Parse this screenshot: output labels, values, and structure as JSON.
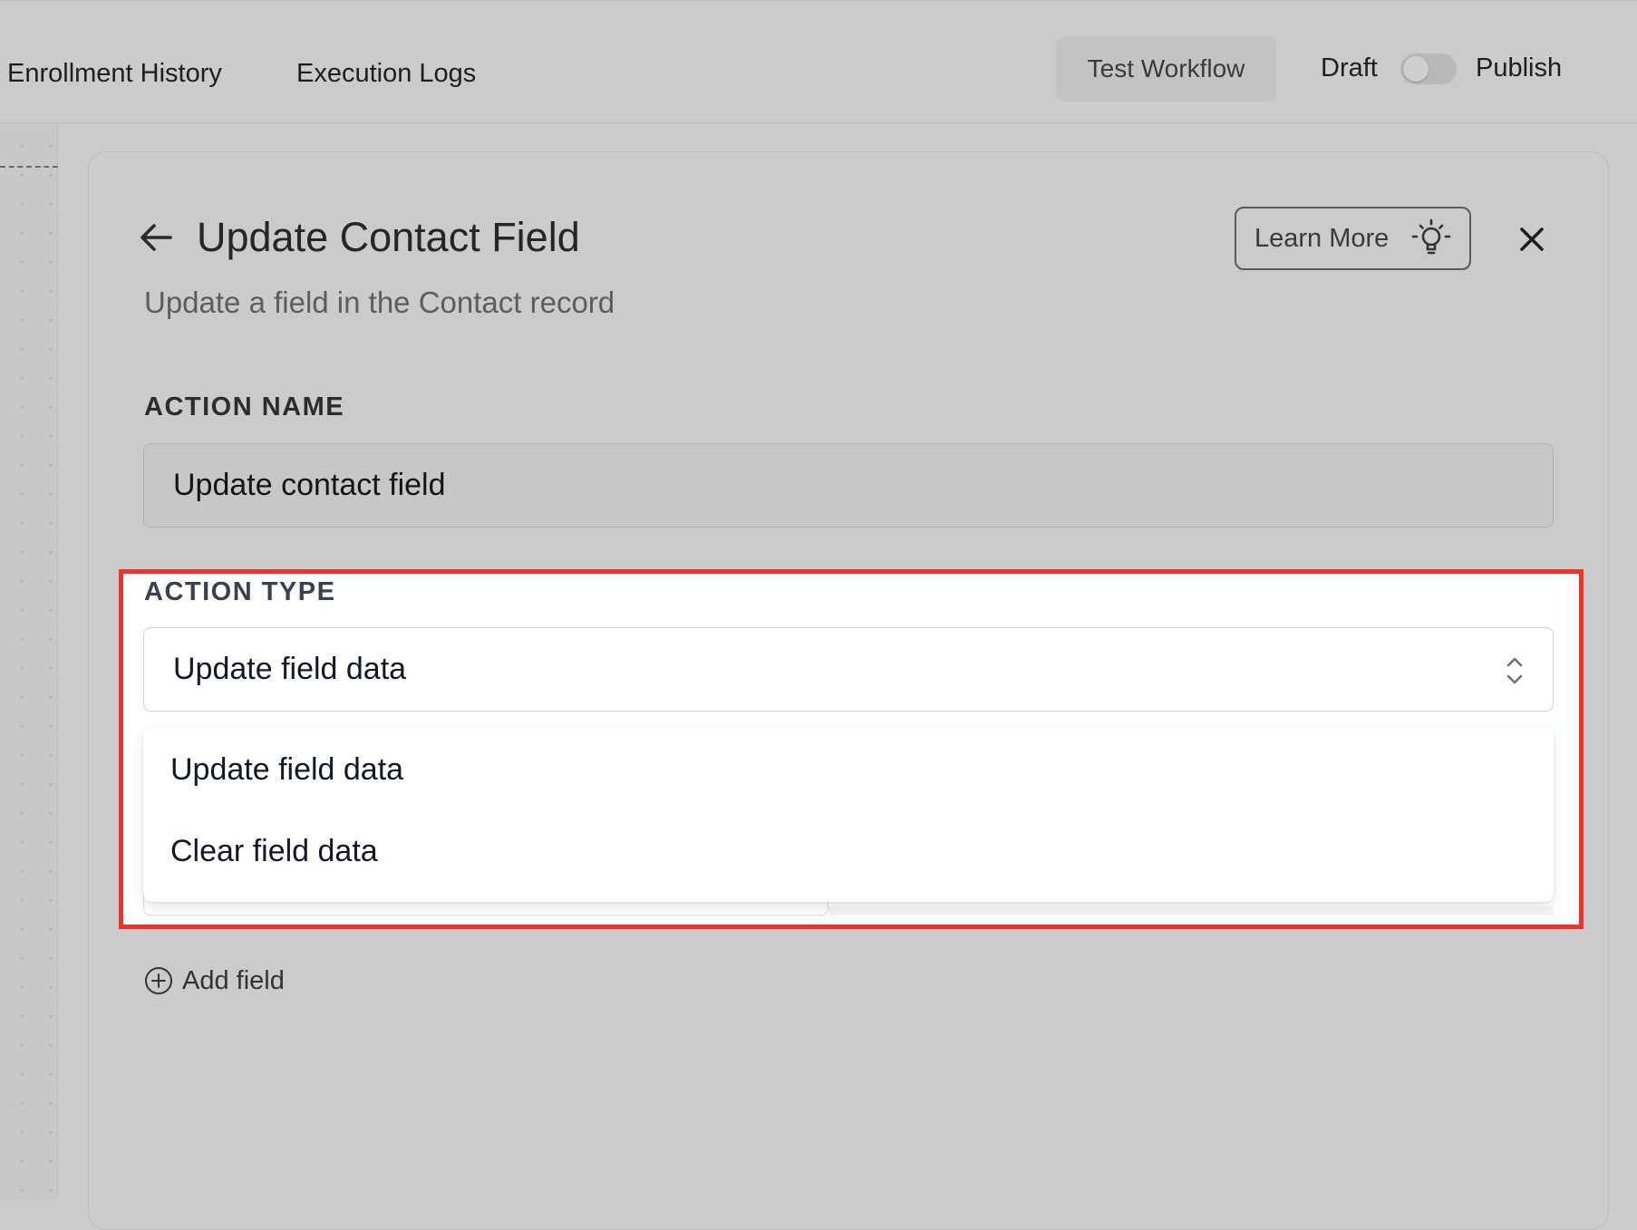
{
  "topbar": {
    "tabs": [
      "Enrollment History",
      "Execution Logs"
    ],
    "test_button": "Test Workflow",
    "draft_label": "Draft",
    "publish_label": "Publish",
    "publish_toggle_on": false
  },
  "panel": {
    "title": "Update Contact Field",
    "subtitle": "Update a field in the Contact record",
    "learn_more": "Learn More",
    "action_name": {
      "label": "ACTION NAME",
      "value": "Update contact field"
    },
    "action_type": {
      "label": "ACTION TYPE",
      "selected": "Update field data",
      "options": [
        "Update field data",
        "Clear field data"
      ]
    },
    "add_field": "Add field"
  },
  "colors": {
    "highlight_border": "#ee3428",
    "overlay_bg": "#cbcbcb"
  }
}
